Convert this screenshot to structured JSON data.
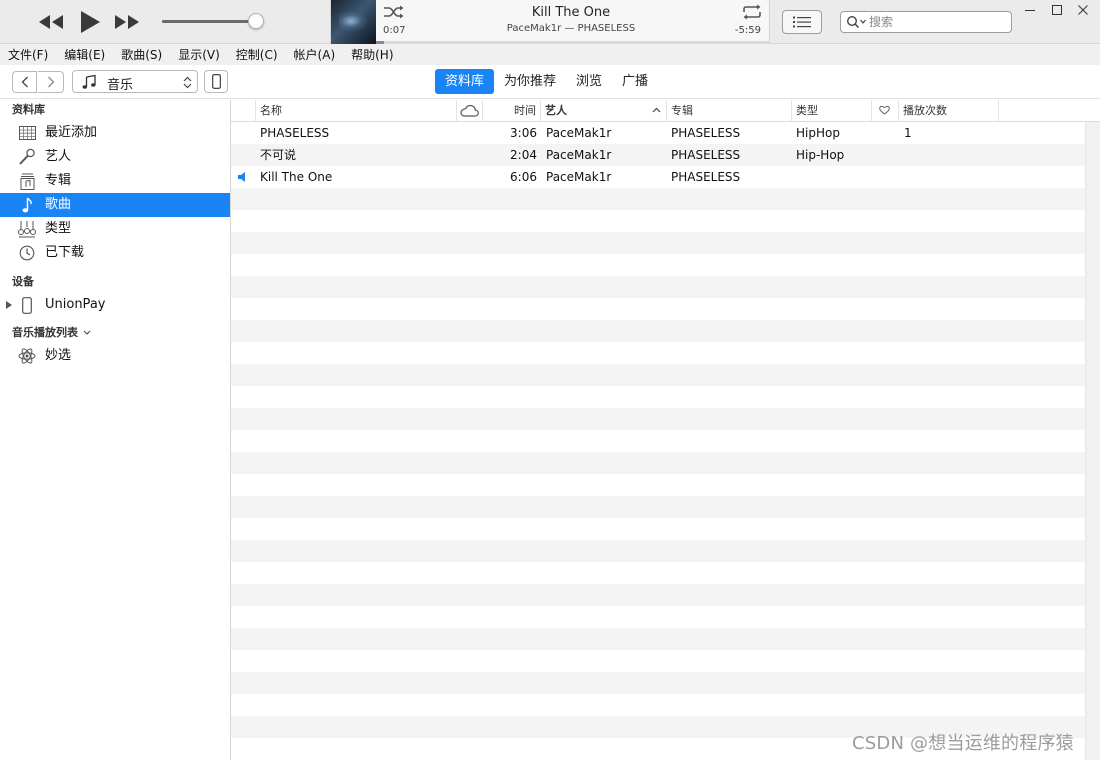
{
  "player": {
    "now_playing": {
      "title": "Kill The One",
      "subtitle": "PaceMak1r — PHASELESS",
      "elapsed": "0:07",
      "remaining": "-5:59",
      "progress": 0.02
    },
    "volume": 0.9,
    "search": {
      "placeholder": "搜索",
      "value": ""
    }
  },
  "menu": [
    "文件(F)",
    "编辑(E)",
    "歌曲(S)",
    "显示(V)",
    "控制(C)",
    "帐户(A)",
    "帮助(H)"
  ],
  "nav": {
    "media_type": "音乐",
    "tabs": [
      {
        "label": "资料库",
        "active": true
      },
      {
        "label": "为你推荐",
        "active": false
      },
      {
        "label": "浏览",
        "active": false
      },
      {
        "label": "广播",
        "active": false
      }
    ]
  },
  "sidebar": {
    "library_header": "资料库",
    "library_items": [
      {
        "label": "最近添加",
        "icon": "grid-icon"
      },
      {
        "label": "艺人",
        "icon": "microphone-icon"
      },
      {
        "label": "专辑",
        "icon": "album-icon"
      },
      {
        "label": "歌曲",
        "icon": "music-note-icon",
        "selected": true
      },
      {
        "label": "类型",
        "icon": "genre-icon"
      },
      {
        "label": "已下载",
        "icon": "download-clock-icon"
      }
    ],
    "devices_header": "设备",
    "devices": [
      {
        "label": "UnionPay",
        "icon": "phone-icon"
      }
    ],
    "playlists_header": "音乐播放列表",
    "playlists": [
      {
        "label": "妙选",
        "icon": "genius-icon"
      }
    ]
  },
  "table": {
    "headers": {
      "name": "名称",
      "time": "时间",
      "artist": "艺人",
      "album": "专辑",
      "genre": "类型",
      "plays": "播放次数"
    },
    "rows": [
      {
        "name": "PHASELESS",
        "time": "3:06",
        "artist": "PaceMak1r",
        "album": "PHASELESS",
        "genre": "HipHop",
        "plays": "1",
        "playing": false
      },
      {
        "name": "不可说",
        "time": "2:04",
        "artist": "PaceMak1r",
        "album": "PHASELESS",
        "genre": "Hip-Hop",
        "plays": "",
        "playing": false
      },
      {
        "name": "Kill The One",
        "time": "6:06",
        "artist": "PaceMak1r",
        "album": "PHASELESS",
        "genre": "",
        "plays": "",
        "playing": true
      }
    ]
  },
  "watermark": "CSDN @想当运维的程序猿",
  "colors": {
    "accent": "#1a84f5",
    "stripe": "#f4f4f4"
  }
}
